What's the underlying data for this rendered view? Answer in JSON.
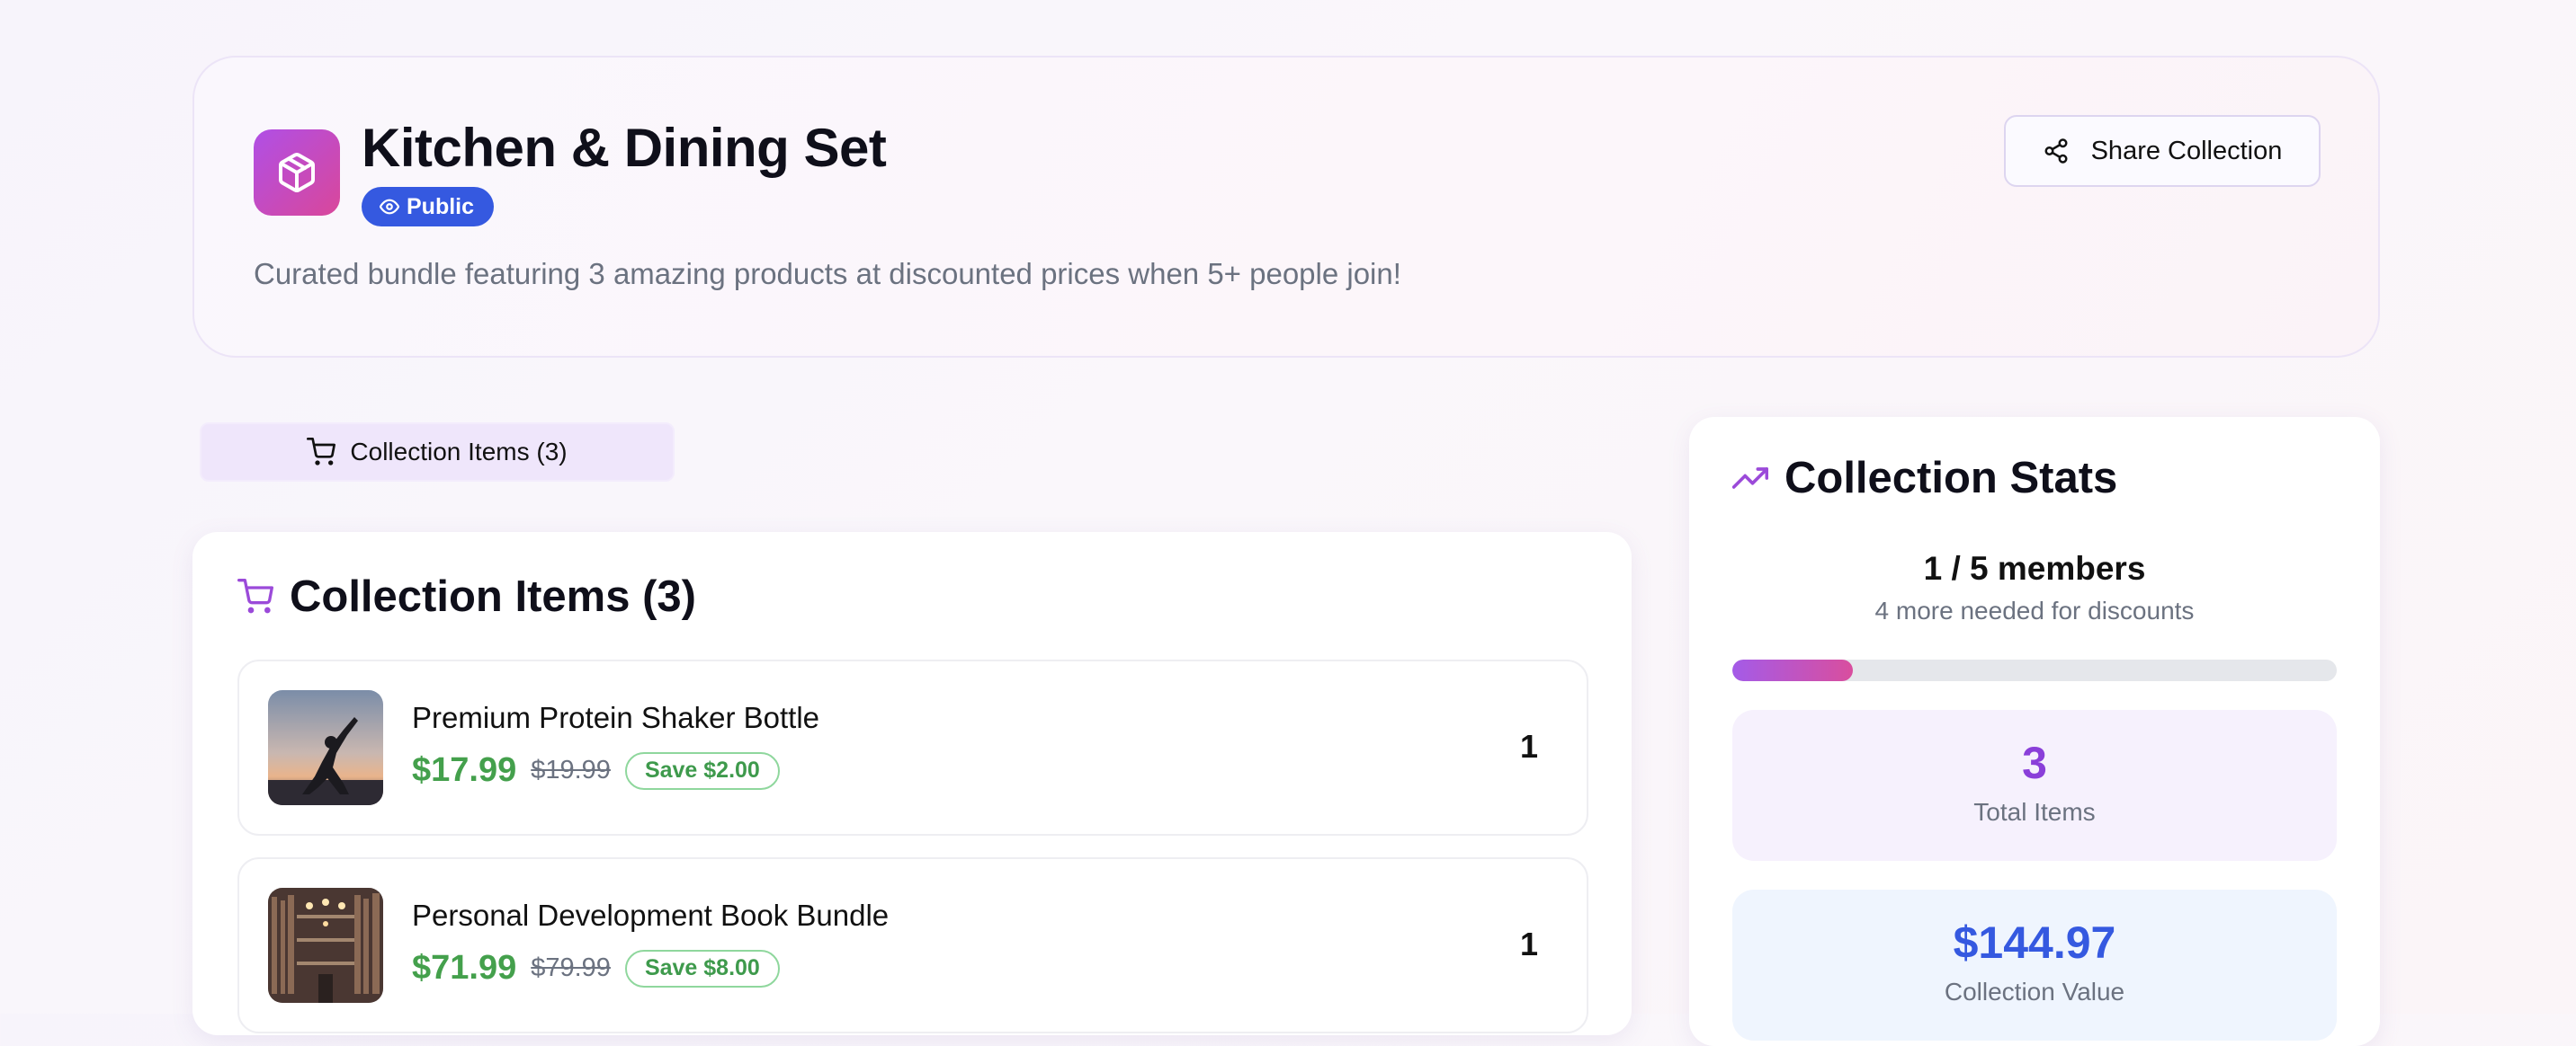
{
  "header": {
    "title": "Kitchen & Dining Set",
    "visibility_badge": "Public",
    "description": "Curated bundle featuring 3 amazing products at discounted prices when 5+ people join!",
    "share_button": "Share Collection",
    "icon": "package-icon"
  },
  "tabs": [
    {
      "label": "Collection Items (3)",
      "icon": "cart-icon",
      "active": true
    }
  ],
  "items_section": {
    "title": "Collection Items (3)",
    "icon": "cart-icon",
    "items": [
      {
        "name": "Premium Protein Shaker Bottle",
        "price": "$17.99",
        "original_price": "$19.99",
        "savings": "Save $2.00",
        "quantity": "1",
        "image": "yoga-pose-photo"
      },
      {
        "name": "Personal Development Book Bundle",
        "price": "$71.99",
        "original_price": "$79.99",
        "savings": "Save $8.00",
        "quantity": "1",
        "image": "library-bookshelf-photo"
      }
    ]
  },
  "stats": {
    "title": "Collection Stats",
    "icon": "trending-up-icon",
    "members_text": "1 / 5 members",
    "members_sub": "4 more needed for discounts",
    "members_current": 1,
    "members_target": 5,
    "total_items_value": "3",
    "total_items_label": "Total Items",
    "collection_value": "$144.97",
    "collection_value_label": "Collection Value"
  },
  "colors": {
    "accent_purple": "#8a3fd9",
    "accent_blue": "#3559e0",
    "price_green": "#44a04c"
  }
}
